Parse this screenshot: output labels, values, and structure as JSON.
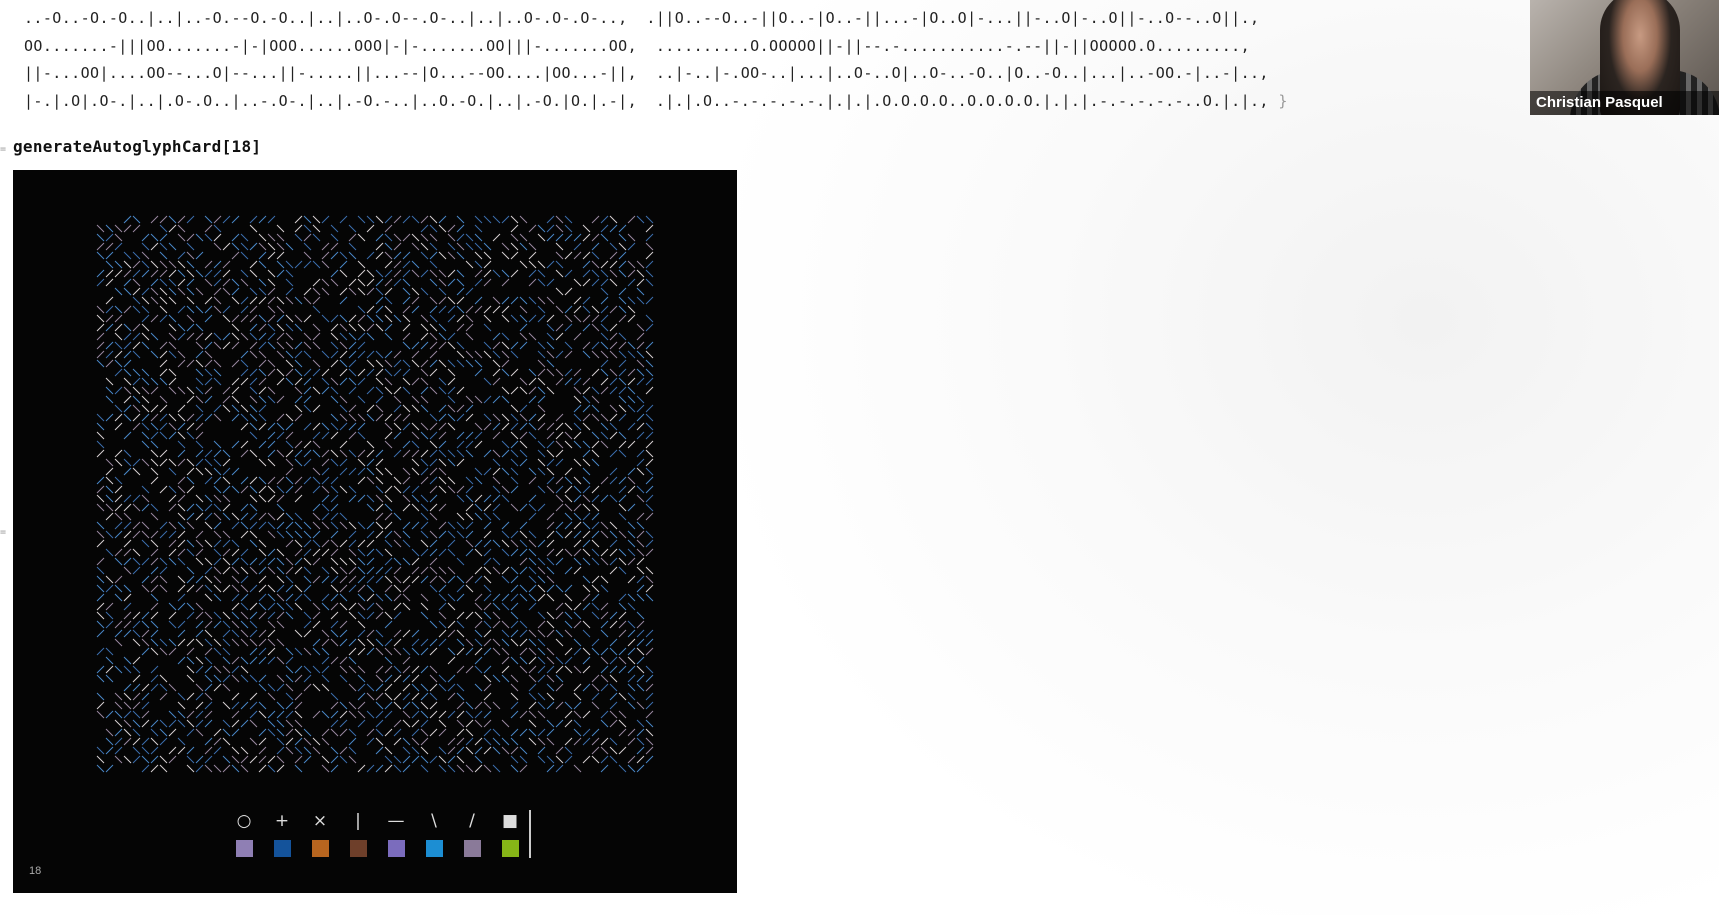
{
  "output": {
    "lines": [
      "..-O..-O.-O..|..|..-O.--O.-O..|..|..O-.O--.O-..|..|..O-.O-.O-..,  .||O..--O..-||O..-|O..-||...-|O..O|-...||-..O|-..O||-..O--..O||.,",
      "OO.......-|||OO.......-|-|OOO......OOO|-|-.......OO|||-.......OO,  ..........O.OOOOO||-||--.-...........-.--||-||OOOOO.O.........,",
      "||-...OO|....OO--...O|--...||-.....||...--|O...--OO....|OO...-||,  ..|-..|-.OO-..|...|..O-..O|..O-..-O..|O..-O..|...|..-OO.-|..-|..,",
      "|-.|.O|.O-.|..|.O-.O..|..-.O-.|..|.-O.-..|..O.-O.|..|.-O.|O.|.-|,  .|.|.O..-.-.-.-.-.|.|.|.O.O.O.O..O.O.O.O.|.|.|.-.-.-.-.-..O.|.|.,"
    ],
    "closing_brace": "}"
  },
  "input_cell": {
    "code": "generateAutoglyphCard[18]"
  },
  "card": {
    "number": "18",
    "legend_symbols": [
      "○",
      "+",
      "×",
      "|",
      "—",
      "\\",
      "/",
      "■"
    ],
    "legend_symbol_names": [
      "circle-icon",
      "plus-icon",
      "cross-icon",
      "vertical-bar-icon",
      "horizontal-bar-icon",
      "backslash-icon",
      "slash-icon",
      "square-icon"
    ],
    "legend_colors": [
      "#8f7fb4",
      "#14539b",
      "#b7651f",
      "#6e3f2a",
      "#7b6cbd",
      "#1c8ed3",
      "#8a7a99",
      "#86b517"
    ],
    "glyph_colors": [
      "#4a88c9",
      "#d8d2d5",
      "#9b8aa2",
      "#3d6fb0"
    ]
  },
  "webcam": {
    "name": "Christian Pasquel"
  }
}
